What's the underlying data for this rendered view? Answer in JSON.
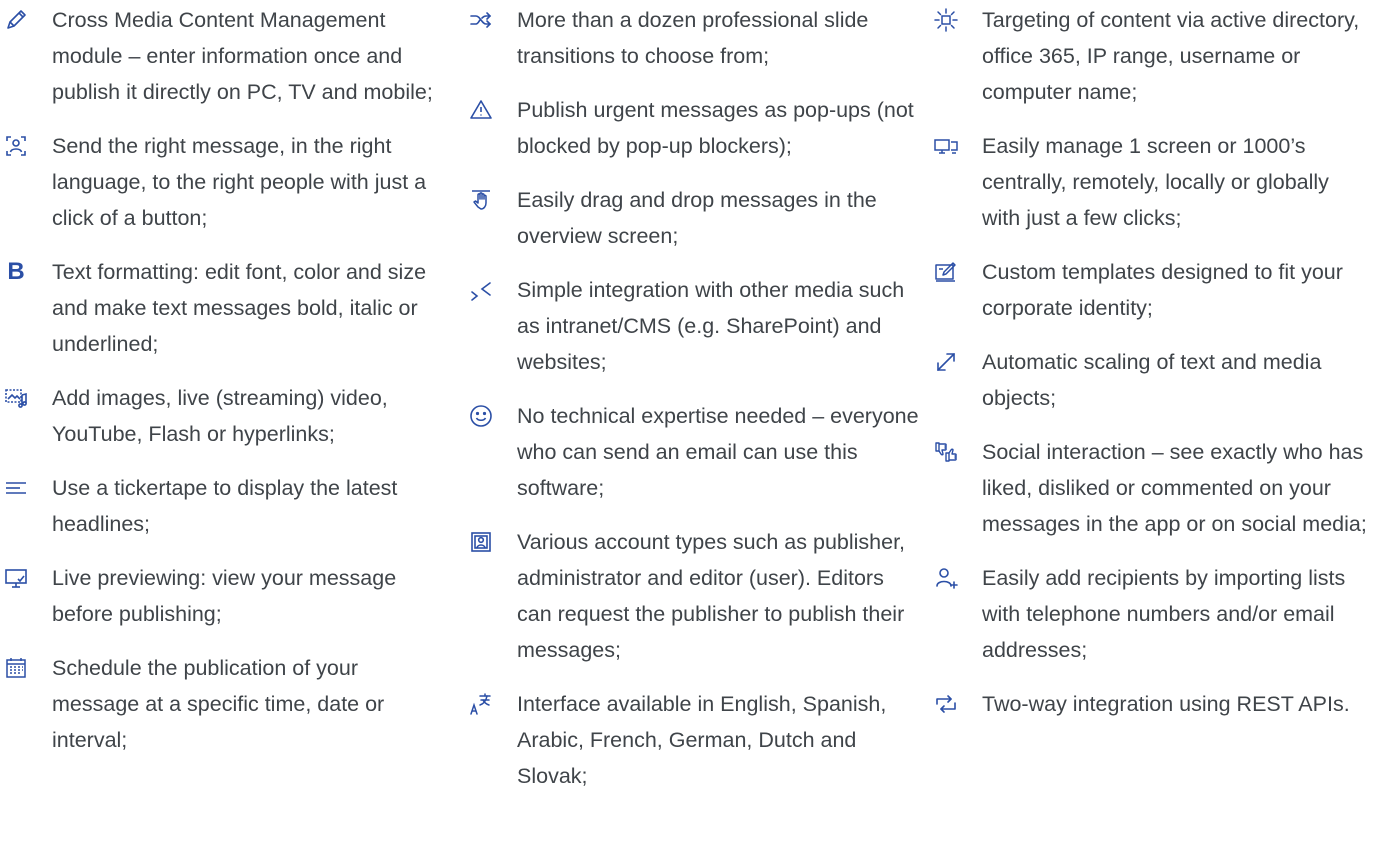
{
  "colors": {
    "text": "#3f4449",
    "icon": "#2b4fa6"
  },
  "columns": [
    {
      "items": [
        {
          "icon": "pencil-icon",
          "text": "Cross Media Content Management module – enter information once and publish it directly on PC, TV and mobile;"
        },
        {
          "icon": "target-person-icon",
          "text": "Send the right message, in the right language, to the right people with just a click of a button;"
        },
        {
          "icon": "bold-icon",
          "glyph": "B",
          "text": "Text formatting: edit font, color and size and make text messages bold, italic or underlined;"
        },
        {
          "icon": "media-icon",
          "text": "Add images, live (streaming) video, YouTube, Flash or hyperlinks;"
        },
        {
          "icon": "ticker-lines-icon",
          "text": "Use a tickertape to display the latest headlines;"
        },
        {
          "icon": "preview-monitor-icon",
          "text": "Live previewing: view your message before publishing;"
        },
        {
          "icon": "calendar-icon",
          "text": "Schedule the publication of your message at a specific time, date or interval;"
        }
      ]
    },
    {
      "items": [
        {
          "icon": "shuffle-icon",
          "text": "More than a dozen professional slide transitions to choose from;"
        },
        {
          "icon": "warning-icon",
          "text": "Publish urgent messages as pop-ups (not blocked by pop-up blockers);"
        },
        {
          "icon": "drag-hand-icon",
          "text": "Easily drag and drop messages in the overview screen;"
        },
        {
          "icon": "integration-arrows-icon",
          "text": "Simple integration with other media such as intranet/CMS (e.g. SharePoint) and websites;"
        },
        {
          "icon": "smiley-icon",
          "text": "No technical expertise needed – everyone who can send an email can use this software;"
        },
        {
          "icon": "account-badge-icon",
          "text": "Various account types such as publisher, administrator and editor (user). Editors can request the publisher to publish their messages;"
        },
        {
          "icon": "language-icon",
          "text": "Interface available in English, Spanish, Arabic, French, German, Dutch and Slovak;"
        }
      ]
    },
    {
      "items": [
        {
          "icon": "targeting-sun-icon",
          "text": "Targeting of content via active directory, office 365, IP range, username or computer name;"
        },
        {
          "icon": "screens-icon",
          "text": "Easily manage 1 screen or 1000’s centrally, remotely, locally or globally with just a few clicks;"
        },
        {
          "icon": "template-edit-icon",
          "text": "Custom templates designed to fit your corporate identity;"
        },
        {
          "icon": "scale-arrow-icon",
          "text": "Automatic scaling of text and media objects;"
        },
        {
          "icon": "thumbs-icon",
          "text": "Social interaction – see exactly who has liked, disliked or commented on your messages in the app or on social media;"
        },
        {
          "icon": "add-user-icon",
          "text": "Easily add recipients by importing lists with telephone numbers and/or email addresses;"
        },
        {
          "icon": "two-way-sync-icon",
          "text": "Two-way integration using REST APIs."
        }
      ]
    }
  ]
}
